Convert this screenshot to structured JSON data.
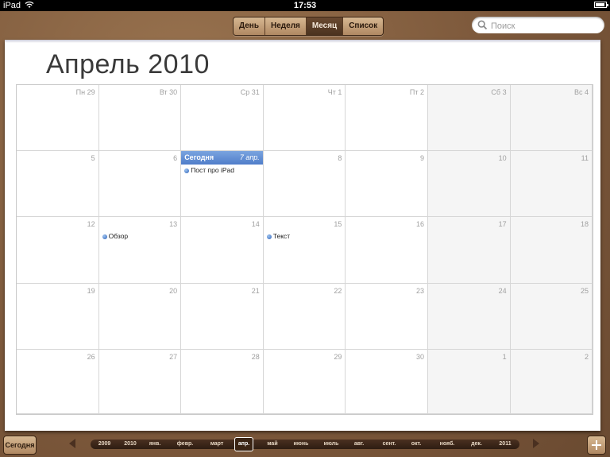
{
  "status": {
    "device": "iPad",
    "time": "17:53"
  },
  "views": [
    "День",
    "Неделя",
    "Месяц",
    "Список"
  ],
  "active_view": "Месяц",
  "search": {
    "placeholder": "Поиск"
  },
  "month_title": "Апрель 2010",
  "weeks": [
    [
      {
        "label": "Пн 29"
      },
      {
        "label": "Вт 30"
      },
      {
        "label": "Ср 31"
      },
      {
        "label": "Чт 1"
      },
      {
        "label": "Пт 2"
      },
      {
        "label": "Сб 3",
        "weekend": true
      },
      {
        "label": "Вс 4",
        "weekend": true
      }
    ],
    [
      {
        "label": "5"
      },
      {
        "label": "6"
      },
      {
        "label": "7",
        "today": true,
        "today_label": "Сегодня",
        "today_date": "7 апр.",
        "events": [
          "Пост про  iPad"
        ]
      },
      {
        "label": "8"
      },
      {
        "label": "9"
      },
      {
        "label": "10",
        "weekend": true
      },
      {
        "label": "11",
        "weekend": true
      }
    ],
    [
      {
        "label": "12"
      },
      {
        "label": "13",
        "events": [
          "Обзор"
        ]
      },
      {
        "label": "14"
      },
      {
        "label": "15",
        "events": [
          "Текст"
        ]
      },
      {
        "label": "16"
      },
      {
        "label": "17",
        "weekend": true
      },
      {
        "label": "18",
        "weekend": true
      }
    ],
    [
      {
        "label": "19"
      },
      {
        "label": "20"
      },
      {
        "label": "21"
      },
      {
        "label": "22"
      },
      {
        "label": "23"
      },
      {
        "label": "24",
        "weekend": true
      },
      {
        "label": "25",
        "weekend": true
      }
    ],
    [
      {
        "label": "26"
      },
      {
        "label": "27"
      },
      {
        "label": "28"
      },
      {
        "label": "29"
      },
      {
        "label": "30"
      },
      {
        "label": "1",
        "weekend": true
      },
      {
        "label": "2",
        "weekend": true
      }
    ]
  ],
  "bottom": {
    "today_button": "Сегодня",
    "timeline": [
      "2009",
      "2010",
      "янв.",
      "февр.",
      "март",
      "апр.",
      "май",
      "июнь",
      "июль",
      "авг.",
      "сент.",
      "окт.",
      "нояб.",
      "дек.",
      "2011"
    ],
    "selected": "апр."
  }
}
